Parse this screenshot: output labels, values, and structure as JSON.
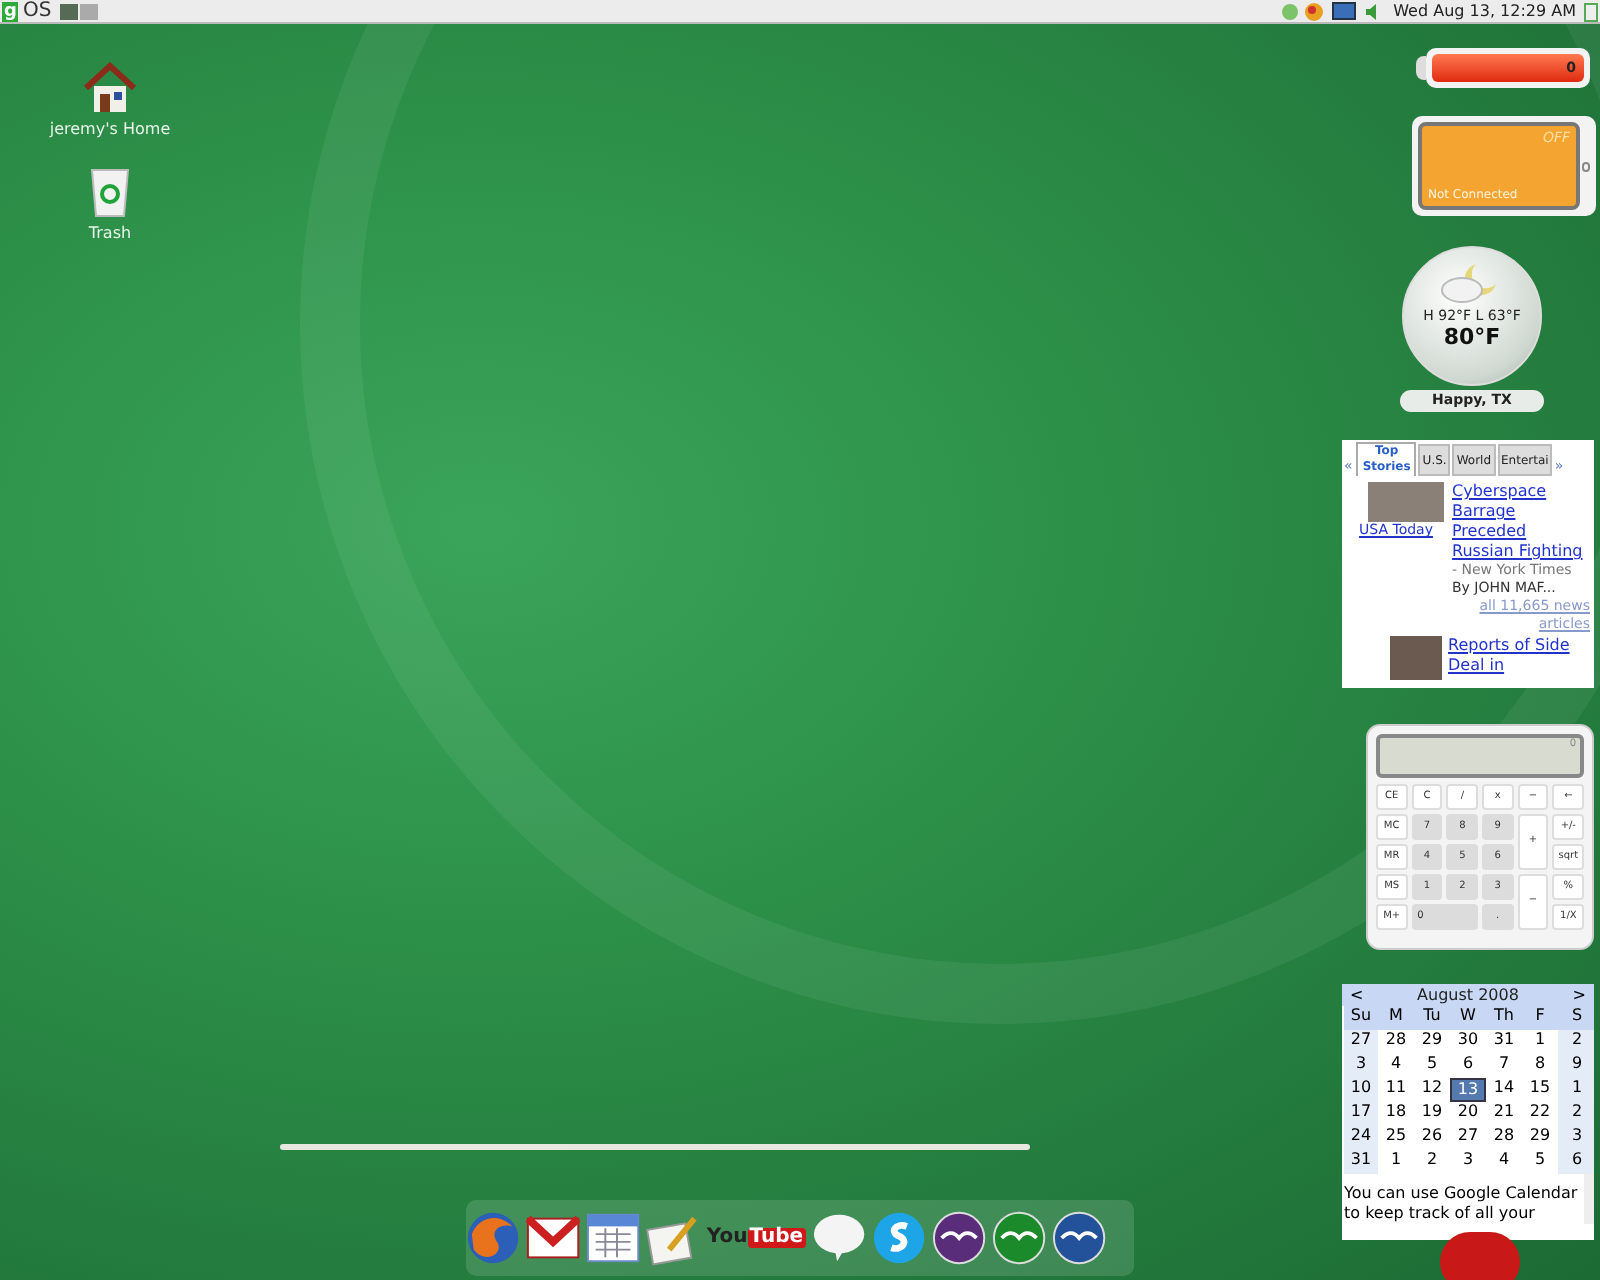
{
  "top_bar": {
    "logo_letter": "g",
    "logo_text": "OS",
    "workspaces": [
      {
        "selected": true
      },
      {
        "selected": false
      }
    ],
    "clock": "Wed Aug 13, 12:29 AM"
  },
  "desktop_icons": [
    {
      "kind": "home",
      "label": "jeremy's Home"
    },
    {
      "kind": "trash",
      "label": "Trash"
    }
  ],
  "meter": {
    "reading": "0"
  },
  "wifi": {
    "status": "OFF",
    "label": "Not Connected"
  },
  "weather": {
    "hi_lo": "H 92°F L 63°F",
    "temperature": "80°F",
    "location": "Happy, TX"
  },
  "news": {
    "prev": "«",
    "next": "»",
    "tabs": [
      {
        "label": "Top Stories",
        "selected": true
      },
      {
        "label": "U.S.",
        "selected": false
      },
      {
        "label": "World",
        "selected": false
      },
      {
        "label": "Entertai",
        "selected": false
      }
    ],
    "story": {
      "source": "USA Today",
      "headline": "Cyberspace Barrage Preceded Russian Fighting",
      "publisher": "- New York Times",
      "byline": "By JOHN MAF...",
      "more": "all 11,665 news articles"
    },
    "story_2": {
      "headline": "Reports of Side Deal in"
    }
  },
  "calculator": {
    "display": "0",
    "keys": [
      {
        "label": "CE",
        "kind": "key"
      },
      {
        "label": "C",
        "kind": "key"
      },
      {
        "label": "/",
        "kind": "key"
      },
      {
        "label": "x",
        "kind": "key"
      },
      {
        "label": "−",
        "kind": "key"
      },
      {
        "label": "←",
        "kind": "key"
      },
      {
        "label": "MC",
        "kind": "key"
      },
      {
        "label": "7",
        "kind": "digit"
      },
      {
        "label": "8",
        "kind": "digit"
      },
      {
        "label": "9",
        "kind": "digit"
      },
      {
        "label": "+",
        "kind": "tall"
      },
      {
        "label": "+/-",
        "kind": "key"
      },
      {
        "label": "MR",
        "kind": "key"
      },
      {
        "label": "4",
        "kind": "digit"
      },
      {
        "label": "5",
        "kind": "digit"
      },
      {
        "label": "6",
        "kind": "digit"
      },
      {
        "label": "sqrt",
        "kind": "key"
      },
      {
        "label": "MS",
        "kind": "key"
      },
      {
        "label": "1",
        "kind": "digit"
      },
      {
        "label": "2",
        "kind": "digit"
      },
      {
        "label": "3",
        "kind": "digit"
      },
      {
        "label": "−",
        "kind": "tall"
      },
      {
        "label": "%",
        "kind": "key"
      },
      {
        "label": "M+",
        "kind": "key"
      },
      {
        "label": "0",
        "kind": "wide"
      },
      {
        "label": ".",
        "kind": "digit"
      },
      {
        "label": "1/X",
        "kind": "key"
      }
    ]
  },
  "calendar": {
    "prev": "<",
    "month": "August 2008",
    "next": ">",
    "weekdays": [
      "Su",
      "M",
      "Tu",
      "W",
      "Th",
      "F",
      "S"
    ],
    "weeks": [
      [
        {
          "day": "27",
          "selected": false
        },
        {
          "day": "28",
          "selected": false
        },
        {
          "day": "29",
          "selected": false
        },
        {
          "day": "30",
          "selected": false
        },
        {
          "day": "31",
          "selected": false
        },
        {
          "day": "1",
          "selected": false
        },
        {
          "day": "2",
          "selected": false
        }
      ],
      [
        {
          "day": "3",
          "selected": false
        },
        {
          "day": "4",
          "selected": false
        },
        {
          "day": "5",
          "selected": false
        },
        {
          "day": "6",
          "selected": false
        },
        {
          "day": "7",
          "selected": false
        },
        {
          "day": "8",
          "selected": false
        },
        {
          "day": "9",
          "selected": false
        }
      ],
      [
        {
          "day": "10",
          "selected": false
        },
        {
          "day": "11",
          "selected": false
        },
        {
          "day": "12",
          "selected": false
        },
        {
          "day": "13",
          "selected": true
        },
        {
          "day": "14",
          "selected": false
        },
        {
          "day": "15",
          "selected": false
        },
        {
          "day": "1",
          "selected": false
        }
      ],
      [
        {
          "day": "17",
          "selected": false
        },
        {
          "day": "18",
          "selected": false
        },
        {
          "day": "19",
          "selected": false
        },
        {
          "day": "20",
          "selected": false
        },
        {
          "day": "21",
          "selected": false
        },
        {
          "day": "22",
          "selected": false
        },
        {
          "day": "2",
          "selected": false
        }
      ],
      [
        {
          "day": "24",
          "selected": false
        },
        {
          "day": "25",
          "selected": false
        },
        {
          "day": "26",
          "selected": false
        },
        {
          "day": "27",
          "selected": false
        },
        {
          "day": "28",
          "selected": false
        },
        {
          "day": "29",
          "selected": false
        },
        {
          "day": "3",
          "selected": false
        }
      ],
      [
        {
          "day": "31",
          "selected": false
        },
        {
          "day": "1",
          "selected": false
        },
        {
          "day": "2",
          "selected": false
        },
        {
          "day": "3",
          "selected": false
        },
        {
          "day": "4",
          "selected": false
        },
        {
          "day": "5",
          "selected": false
        },
        {
          "day": "6",
          "selected": false
        }
      ]
    ],
    "note": "You can use Google Calendar to keep track of all your"
  },
  "dock": [
    {
      "kind": "browser"
    },
    {
      "kind": "mail"
    },
    {
      "kind": "calendar"
    },
    {
      "kind": "editor"
    },
    {
      "kind": "video",
      "text_1": "You",
      "text_2": "Tube"
    },
    {
      "kind": "chat"
    },
    {
      "kind": "phone"
    },
    {
      "kind": "office_purple"
    },
    {
      "kind": "office_green"
    },
    {
      "kind": "office_blue"
    }
  ]
}
